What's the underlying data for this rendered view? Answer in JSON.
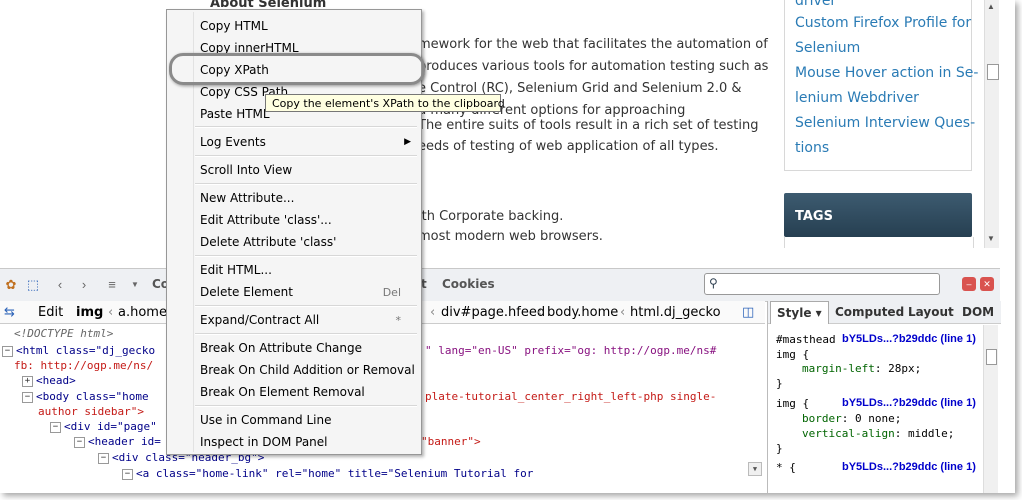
{
  "article": {
    "heading": "About Selenium",
    "lines": [
      "mework for the web that facilitates the automation of",
      "produces various tools for automation testing such as",
      "e Control (RC), Selenium Grid and Selenium 2.0 &",
      "u many different options for approaching",
      "The entire suits of tools result in a rich set of testing",
      "eeds of testing of web application of all types.",
      "ith Corporate backing.",
      "most modern web browsers."
    ]
  },
  "sidebar": {
    "links": [
      "driver",
      "Custom Firefox Profile for",
      "Selenium",
      "Mouse Hover action in Se-",
      "lenium Webdriver",
      "Selenium Interview Ques-",
      "tions"
    ],
    "tags_title": "TAGS"
  },
  "toolbar": {
    "console_partial": "Co",
    "net_partial": "t",
    "cookies": "Cookies",
    "search_placeholder": ""
  },
  "breadcrumb": {
    "edit": "Edit",
    "items": [
      "img",
      "a.home-",
      "div#page.hfeed",
      "body.home",
      "html.dj_gecko"
    ]
  },
  "tree": {
    "doctype": "<!DOCTYPE html>",
    "html_open": "<html class=\"dj_gecko",
    "html_lang": "\" lang=\"en-US\" prefix=\"og: http://ogp.me/ns#",
    "html_fb": "fb: http://ogp.me/ns/",
    "head": "<head>",
    "body_open": "<body class=\"home",
    "body_rest": "plate-tutorial_center_right_left-php single-",
    "body_rest2": "author sidebar\">",
    "div_page": "<div id=\"page\"",
    "header": "<header id=",
    "banner": "\"banner\">",
    "header_bg": "<div class=\"header_bg\">",
    "a_home": "<a class=\"home-link\" rel=\"home\" title=\"Selenium Tutorial for"
  },
  "side_panel": {
    "tabs": [
      "Style ▾",
      "Computed",
      "Layout",
      "DOM"
    ],
    "rules": [
      {
        "selector": "#masthead",
        "source": "bY5LDs...?b29ddc (line 1)"
      },
      {
        "selector": "img {",
        "prop": "margin-left",
        "value": "28px;"
      },
      {
        "selector": "}"
      },
      {
        "selector": "img {",
        "source": "bY5LDs...?b29ddc (line 1)"
      },
      {
        "prop": "border",
        "value": "0 none;"
      },
      {
        "prop": "vertical-align",
        "value": "middle;"
      },
      {
        "selector": "}"
      },
      {
        "selector": "* {",
        "source": "bY5LDs...?b29ddc (line 1)"
      }
    ]
  },
  "context_menu": {
    "items": [
      "Copy HTML",
      "Copy innerHTML",
      "Copy XPath",
      "Copy CSS Path",
      "Paste HTML",
      "Log Events",
      "Scroll Into View",
      "New Attribute...",
      "Edit Attribute 'class'...",
      "Delete Attribute 'class'",
      "Edit HTML...",
      "Delete Element",
      "Expand/Contract All",
      "Break On Attribute Change",
      "Break On Child Addition or Removal",
      "Break On Element Removal",
      "Use in Command Line",
      "Inspect in DOM Panel"
    ],
    "delete_shortcut": "Del",
    "expand_shortcut": "*"
  },
  "tooltip": "Copy the element's XPath to the clipboard",
  "colors": {
    "link": "#2a7bb5",
    "tags_bg": "#2e4a5e",
    "tooltip_bg": "#ffffe1",
    "menu_bg": "#f5f5f5"
  }
}
